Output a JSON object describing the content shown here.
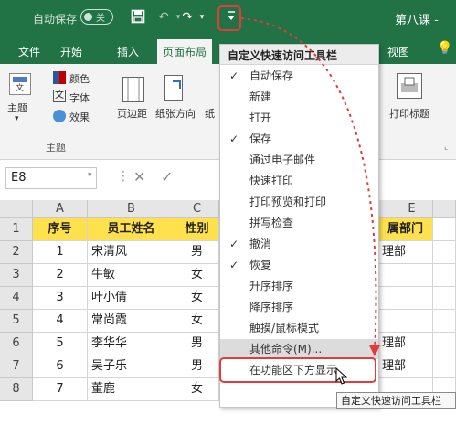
{
  "titlebar": {
    "autosave_label": "自动保存",
    "autosave_state": "关",
    "document_title": "第八课 -"
  },
  "tabs": [
    "文件",
    "开始",
    "插入",
    "页面布局",
    "视图"
  ],
  "ribbon": {
    "theme_label": "主题",
    "colors_label": "颜色",
    "fonts_label": "字体",
    "effects_label": "效果",
    "group_label": "主题",
    "margins_label": "页边距",
    "orientation_label": "纸张方向",
    "size_label": "纸",
    "print_titles_label": "打印标题"
  },
  "formula_bar": {
    "name_box": "E8"
  },
  "sheet": {
    "columns": [
      "A",
      "B",
      "C",
      "E"
    ],
    "rows": [
      "1",
      "2",
      "3",
      "4",
      "5",
      "6",
      "7",
      "8"
    ],
    "header": [
      "序号",
      "员工姓名",
      "性别",
      "属部门"
    ],
    "data": [
      [
        "1",
        "宋清风",
        "男",
        "理部"
      ],
      [
        "2",
        "牛敏",
        "女",
        ""
      ],
      [
        "3",
        "叶小倩",
        "女",
        ""
      ],
      [
        "4",
        "常尚霞",
        "女",
        ""
      ],
      [
        "5",
        "李华华",
        "男",
        "理部"
      ],
      [
        "6",
        "吴子乐",
        "男",
        "理部"
      ],
      [
        "7",
        "董鹿",
        "女",
        ""
      ]
    ]
  },
  "menu": {
    "title": "自定义快速访问工具栏",
    "items": [
      {
        "label": "自动保存",
        "checked": true
      },
      {
        "label": "新建",
        "checked": false
      },
      {
        "label": "打开",
        "checked": false
      },
      {
        "label": "保存",
        "checked": true
      },
      {
        "label": "通过电子邮件",
        "checked": false
      },
      {
        "label": "快速打印",
        "checked": false
      },
      {
        "label": "打印预览和打印",
        "checked": false
      },
      {
        "label": "拼写检查",
        "checked": false
      },
      {
        "label": "撤消",
        "checked": true
      },
      {
        "label": "恢复",
        "checked": true
      },
      {
        "label": "升序排序",
        "checked": false
      },
      {
        "label": "降序排序",
        "checked": false
      },
      {
        "label": "触摸/鼠标模式",
        "checked": false
      },
      {
        "label": "其他命令(M)...",
        "checked": false
      },
      {
        "label": "在功能区下方显示",
        "checked": false
      }
    ],
    "highlighted_index": 13
  },
  "tooltip": "自定义快速访问工具栏",
  "colors": {
    "excel_green": "#217346",
    "header_yellow": "#ffe14d",
    "annotation_red": "#e03c3c"
  }
}
